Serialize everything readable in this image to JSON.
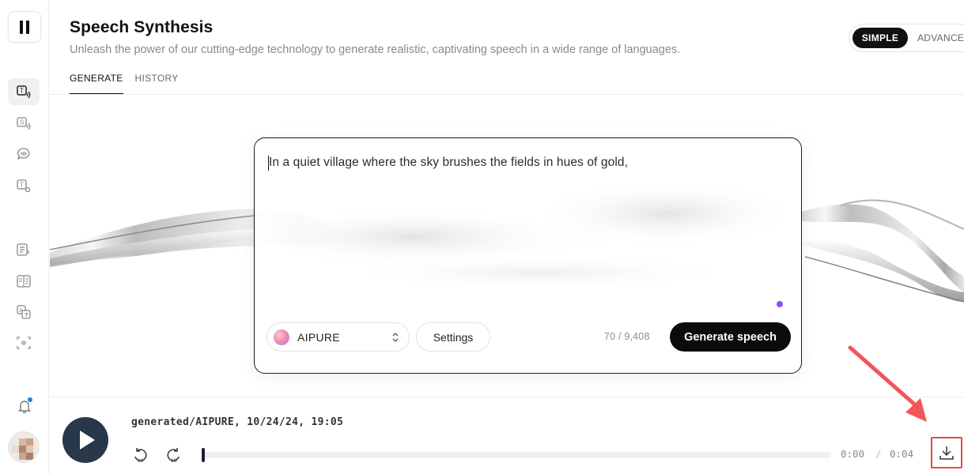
{
  "header": {
    "title": "Speech Synthesis",
    "subtitle": "Unleash the power of our cutting-edge technology to generate realistic, captivating speech in a wide range of languages.",
    "tabs": [
      "GENERATE",
      "HISTORY"
    ],
    "mode": {
      "simple": "SIMPLE",
      "advanced": "ADVANCE"
    }
  },
  "sidebar": {
    "items": [
      {
        "icon": "text-to-speech-icon",
        "active": true
      },
      {
        "icon": "speech-to-speech-icon",
        "active": false
      },
      {
        "icon": "voice-chat-icon",
        "active": false
      },
      {
        "icon": "text-settings-icon",
        "active": false
      },
      {
        "icon": "document-audio-icon",
        "active": false
      },
      {
        "icon": "compare-icon",
        "active": false
      },
      {
        "icon": "translate-icon",
        "active": false
      },
      {
        "icon": "voice-scan-icon",
        "active": false
      }
    ],
    "notification_dot_color": "#1e7cf2"
  },
  "editor": {
    "text": "In a quiet village where the sky brushes the fields in hues of gold,",
    "voice": "AIPURE",
    "settings_label": "Settings",
    "counter": "70 / 9,408",
    "generate_label": "Generate speech"
  },
  "player": {
    "track": "generated/AIPURE, 10/24/24, 19:05",
    "current_time": "0:00",
    "separator": "/",
    "duration": "0:04",
    "progress_fraction": 0
  },
  "colors": {
    "accent": "#111111",
    "play_button": "#29374a",
    "highlight_box": "#e5494b",
    "purple_dot": "#8a4dff"
  }
}
